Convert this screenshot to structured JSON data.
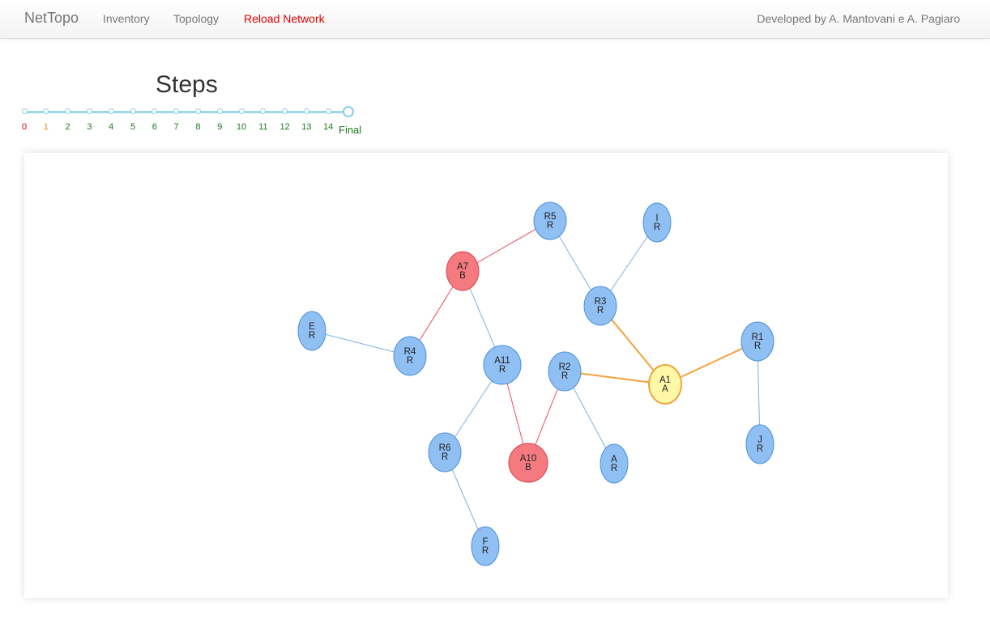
{
  "navbar": {
    "brand": "NetTopo",
    "links": [
      "Inventory",
      "Topology",
      "Reload Network"
    ],
    "credit": "Developed by A. Mantovani e A. Pagiaro"
  },
  "steps": {
    "title": "Steps",
    "labels": [
      "0",
      "1",
      "2",
      "3",
      "4",
      "5",
      "6",
      "7",
      "8",
      "9",
      "10",
      "11",
      "12",
      "13",
      "14"
    ],
    "final_label": "Final",
    "selected": "Final",
    "colors": {
      "first": "#e00000",
      "second": "#f08c00",
      "rest": "#1a7a1a",
      "track": "#9ad8ea"
    }
  },
  "graph": {
    "node_colors": {
      "R": "#90bff3",
      "B": "#f47a80",
      "A": "#fdf9a8"
    },
    "edge_colors": {
      "default": "#7fb2e5",
      "red": "#e84a5f",
      "orange": "#f5a13b"
    },
    "nodes": [
      {
        "id": "R5",
        "line1": "R5",
        "line2": "R",
        "type": "R"
      },
      {
        "id": "I",
        "line1": "I",
        "line2": "R",
        "type": "R"
      },
      {
        "id": "A7",
        "line1": "A7",
        "line2": "B",
        "type": "B"
      },
      {
        "id": "R3",
        "line1": "R3",
        "line2": "R",
        "type": "R"
      },
      {
        "id": "E",
        "line1": "E",
        "line2": "R",
        "type": "R"
      },
      {
        "id": "R4",
        "line1": "R4",
        "line2": "R",
        "type": "R"
      },
      {
        "id": "A11",
        "line1": "A11",
        "line2": "R",
        "type": "R"
      },
      {
        "id": "R2",
        "line1": "R2",
        "line2": "R",
        "type": "R"
      },
      {
        "id": "A1",
        "line1": "A1",
        "line2": "A",
        "type": "A"
      },
      {
        "id": "R1",
        "line1": "R1",
        "line2": "R",
        "type": "R"
      },
      {
        "id": "R6",
        "line1": "R6",
        "line2": "R",
        "type": "R"
      },
      {
        "id": "A10",
        "line1": "A10",
        "line2": "B",
        "type": "B"
      },
      {
        "id": "AR",
        "line1": "A",
        "line2": "R",
        "type": "R"
      },
      {
        "id": "J",
        "line1": "J",
        "line2": "R",
        "type": "R"
      },
      {
        "id": "F",
        "line1": "F",
        "line2": "R",
        "type": "R"
      }
    ],
    "edges": [
      {
        "from": "A7",
        "to": "R5",
        "style": "red"
      },
      {
        "from": "R5",
        "to": "R3",
        "style": "default"
      },
      {
        "from": "I",
        "to": "R3",
        "style": "default"
      },
      {
        "from": "R3",
        "to": "A1",
        "style": "orange"
      },
      {
        "from": "A7",
        "to": "R4",
        "style": "red"
      },
      {
        "from": "A7",
        "to": "A11",
        "style": "default"
      },
      {
        "from": "E",
        "to": "R4",
        "style": "default"
      },
      {
        "from": "A11",
        "to": "R6",
        "style": "default"
      },
      {
        "from": "A11",
        "to": "A10",
        "style": "red"
      },
      {
        "from": "R2",
        "to": "A10",
        "style": "red"
      },
      {
        "from": "R2",
        "to": "AR",
        "style": "default"
      },
      {
        "from": "R2",
        "to": "A1",
        "style": "orange"
      },
      {
        "from": "A1",
        "to": "R1",
        "style": "orange"
      },
      {
        "from": "R1",
        "to": "J",
        "style": "default"
      },
      {
        "from": "R6",
        "to": "F",
        "style": "default"
      }
    ]
  }
}
